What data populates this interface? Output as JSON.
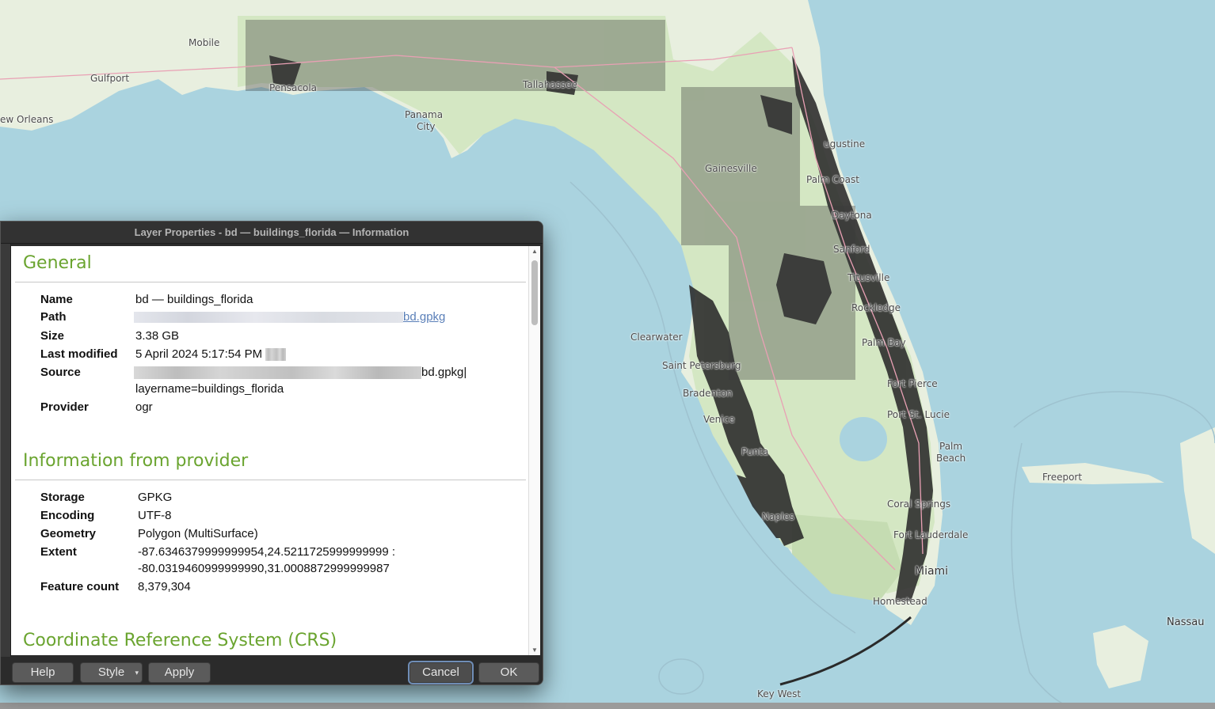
{
  "map": {
    "labels": [
      "Mobile",
      "Gulfport",
      "ew Orleans",
      "Tallahassee",
      "Panama",
      "City",
      "Pensacola",
      "ugustine",
      "Gainesville",
      "Palm Coast",
      "Daytona",
      "Sanford",
      "Titusville",
      "Rockledge",
      "Clearwater",
      "Saint Petersburg",
      "Palm Bay",
      "Fort Pierce",
      "Bradenton",
      "Venice",
      "Port St. Lucie",
      "Palm",
      "Beach",
      "Punta",
      "Freeport",
      "Coral Springs",
      "Naples",
      "Fort Lauderdale",
      "Miami",
      "Homestead",
      "Nassau",
      "Key West"
    ]
  },
  "dialog": {
    "title": "Layer Properties - bd — buildings_florida — Information",
    "general": {
      "heading": "General",
      "rows": [
        {
          "key": "Name",
          "value": "bd — buildings_florida"
        },
        {
          "key": "Path",
          "value": "bd.gpkg"
        },
        {
          "key": "Size",
          "value": "3.38 GB"
        },
        {
          "key": "Last modified",
          "value": "5 April 2024 5:17:54 PM"
        },
        {
          "key": "Source",
          "value": "bd.gpkg|",
          "value2": "layername=buildings_florida"
        },
        {
          "key": "Provider",
          "value": "ogr"
        }
      ]
    },
    "provider": {
      "heading": "Information from provider",
      "rows": [
        {
          "key": "Storage",
          "value": "GPKG"
        },
        {
          "key": "Encoding",
          "value": "UTF-8"
        },
        {
          "key": "Geometry",
          "value": "Polygon (MultiSurface)"
        },
        {
          "key": "Extent",
          "value": "-87.6346379999999954,24.5211725999999999 :",
          "value2": "-80.0319460999999990,31.0008872999999987"
        },
        {
          "key": "Feature count",
          "value": "8,379,304"
        }
      ]
    },
    "crs": {
      "heading": "Coordinate Reference System (CRS)"
    },
    "buttons": {
      "help": "Help",
      "style": "Style",
      "apply": "Apply",
      "cancel": "Cancel",
      "ok": "OK"
    }
  },
  "colors": {
    "accent_heading": "#6aa42f",
    "water": "#aad3df",
    "land": "#d4e7c3",
    "buildings": "#2a2a2a"
  }
}
